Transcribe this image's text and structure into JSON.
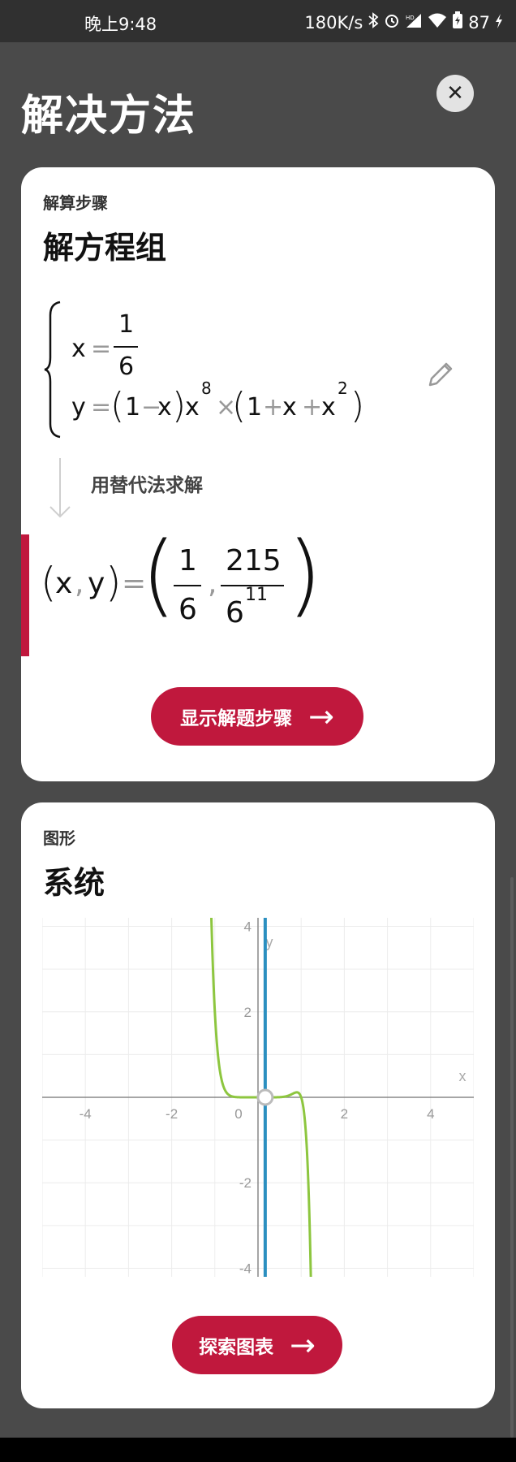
{
  "status": {
    "time": "晚上9:48",
    "speed": "180K/s",
    "battery": "87",
    "icons": [
      "bluetooth-icon",
      "alarm-icon",
      "hd-signal-icon",
      "wifi-icon",
      "battery-icon",
      "charging-icon"
    ]
  },
  "header": {
    "title": "解决方法",
    "close_label": "✕"
  },
  "solution": {
    "label": "解算步骤",
    "heading": "解方程组",
    "eq1": {
      "var": "x",
      "eq": "=",
      "num": "1",
      "den": "6"
    },
    "eq2": {
      "var": "y",
      "eq": "=",
      "one": "1",
      "minus": "−",
      "x": "x",
      "exp8": "8",
      "times": "×",
      "plus": "+",
      "x2": "x",
      "exp2": "2"
    },
    "method": "用替代法求解",
    "result": {
      "lhs_x": "x",
      "comma": ",",
      "lhs_y": "y",
      "eq": "=",
      "num1": "1",
      "den1": "6",
      "num2": "215",
      "den2_base": "6",
      "den2_exp": "11"
    },
    "button": "显示解题步骤"
  },
  "graph_card": {
    "label": "图形",
    "heading": "系统",
    "button": "探索图表"
  },
  "chart_data": {
    "type": "line",
    "xlabel": "x",
    "ylabel": "y",
    "xlim": [
      -5,
      5
    ],
    "ylim": [
      -4.2,
      4.2
    ],
    "xticks": [
      "-4",
      "-2",
      "0",
      "2",
      "4"
    ],
    "yticks": [
      "4",
      "2",
      "-2",
      "-4"
    ],
    "grid": true,
    "series": [
      {
        "kind": "function",
        "expr": "y=(1-x)*x^8*(1+x+x^2)",
        "color": "#8dc63f"
      },
      {
        "kind": "vertical",
        "x": 0.1667,
        "color": "#2b8fc0"
      }
    ],
    "intersection": {
      "x": 0.1667,
      "y": 0.0
    }
  },
  "colors": {
    "accent": "#c0183d",
    "curve": "#8dc63f",
    "line": "#2b8fc0"
  }
}
